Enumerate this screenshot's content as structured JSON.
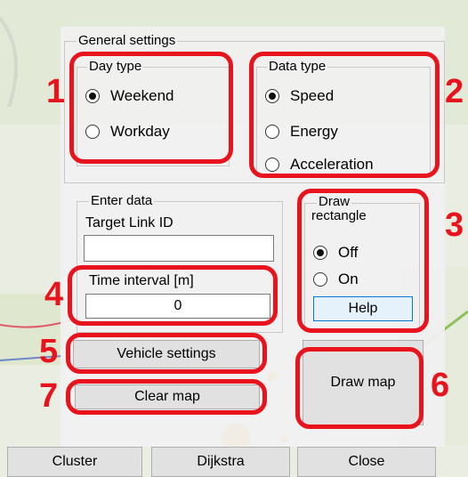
{
  "general_settings": {
    "legend": "General settings"
  },
  "day_type": {
    "legend": "Day type",
    "options": [
      {
        "label": "Weekend",
        "selected": true
      },
      {
        "label": "Workday",
        "selected": false
      }
    ]
  },
  "data_type": {
    "legend": "Data type",
    "options": [
      {
        "label": "Speed",
        "selected": true
      },
      {
        "label": "Energy",
        "selected": false
      },
      {
        "label": "Acceleration",
        "selected": false
      }
    ]
  },
  "enter_data": {
    "legend": "Enter data",
    "target_link_label": "Target Link ID",
    "target_link_value": "",
    "time_interval_label": "Time interval [m]",
    "time_interval_value": "0"
  },
  "draw_rectangle": {
    "legend_line1": "Draw",
    "legend_line2": "rectangle",
    "options": [
      {
        "label": "Off",
        "selected": true
      },
      {
        "label": "On",
        "selected": false
      }
    ],
    "help_label": "Help"
  },
  "buttons": {
    "vehicle_settings": "Vehicle settings",
    "clear_map": "Clear map",
    "draw_map": "Draw map",
    "cluster": "Cluster",
    "dijkstra": "Dijkstra",
    "close": "Close"
  },
  "annotations": [
    "1",
    "2",
    "3",
    "4",
    "5",
    "6",
    "7"
  ],
  "colors": {
    "highlight": "#e8131c",
    "panel": "#f0f0f0",
    "help_border": "#0078d7"
  }
}
